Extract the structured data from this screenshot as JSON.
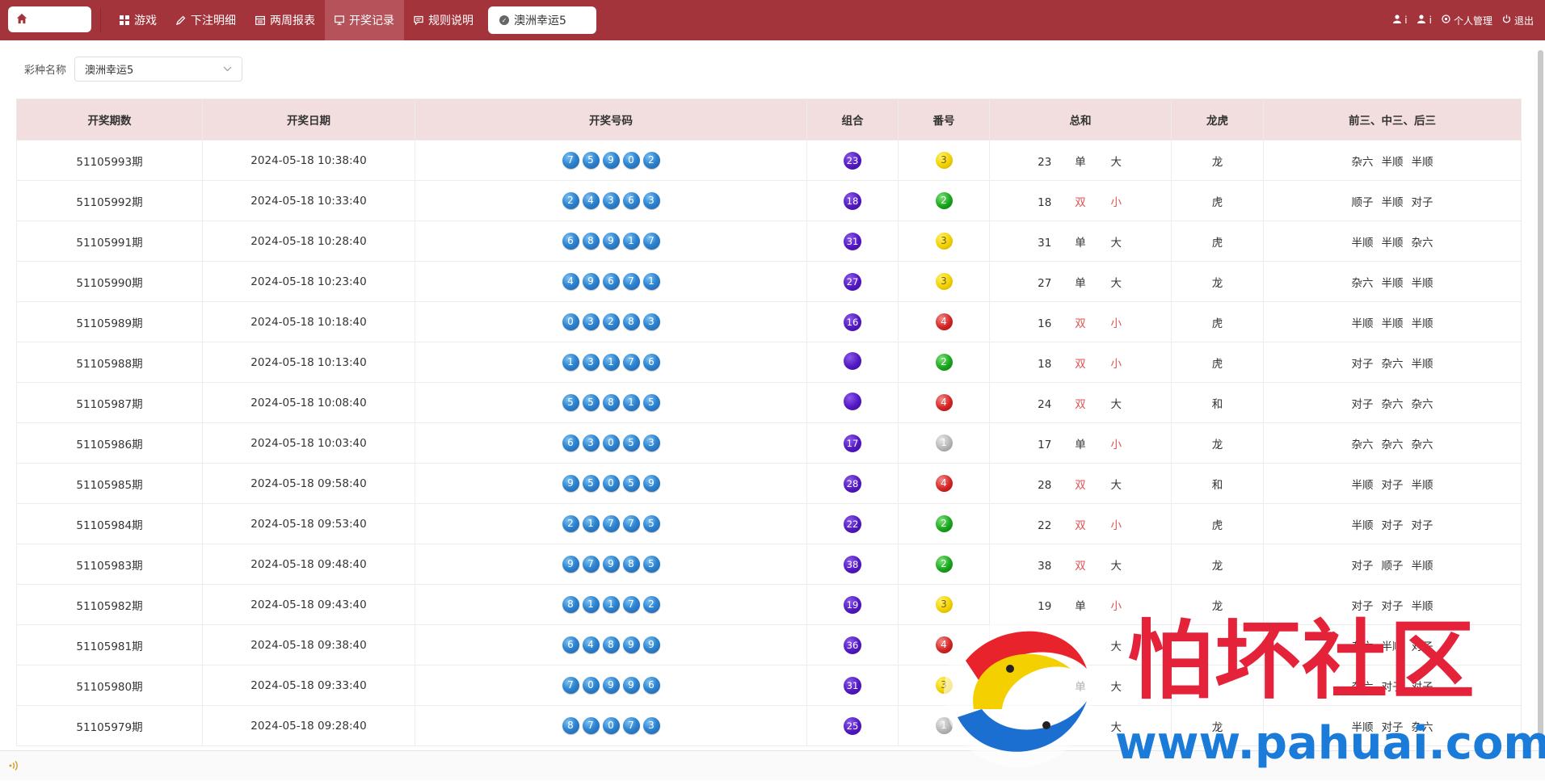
{
  "topbar": {
    "nav": [
      {
        "label": "游戏",
        "icon": "grid-icon"
      },
      {
        "label": "下注明细",
        "icon": "pen-icon"
      },
      {
        "label": "两周报表",
        "icon": "calendar-icon"
      },
      {
        "label": "开奖记录",
        "icon": "monitor-icon",
        "active": true
      },
      {
        "label": "规则说明",
        "icon": "message-icon"
      }
    ],
    "active_tab": "澳洲幸运5",
    "user_glyph_1": "ⅰ",
    "user_glyph_2": "ⅰ",
    "personal": "个人管理",
    "logout": "退出"
  },
  "filter": {
    "label": "彩种名称",
    "selected": "澳洲幸运5"
  },
  "table": {
    "headers": [
      "开奖期数",
      "开奖日期",
      "开奖号码",
      "组合",
      "番号",
      "总和",
      "龙虎",
      "前三、中三、后三"
    ],
    "rows": [
      {
        "issue": "51105993期",
        "date": "2024-05-18 10:38:40",
        "nums": [
          "7",
          "5",
          "9",
          "0",
          "2"
        ],
        "combo": "23",
        "fan": "3",
        "fan_color": "yellow",
        "sum": "23",
        "oe": "单",
        "bs": "大",
        "dt": "龙",
        "pattern": [
          "杂六",
          "半顺",
          "半顺"
        ]
      },
      {
        "issue": "51105992期",
        "date": "2024-05-18 10:33:40",
        "nums": [
          "2",
          "4",
          "3",
          "6",
          "3"
        ],
        "combo": "18",
        "fan": "2",
        "fan_color": "green",
        "sum": "18",
        "oe": "双",
        "bs": "小",
        "dt": "虎",
        "pattern": [
          "顺子",
          "半顺",
          "对子"
        ]
      },
      {
        "issue": "51105991期",
        "date": "2024-05-18 10:28:40",
        "nums": [
          "6",
          "8",
          "9",
          "1",
          "7"
        ],
        "combo": "31",
        "fan": "3",
        "fan_color": "yellow",
        "sum": "31",
        "oe": "单",
        "bs": "大",
        "dt": "虎",
        "pattern": [
          "半顺",
          "半顺",
          "杂六"
        ]
      },
      {
        "issue": "51105990期",
        "date": "2024-05-18 10:23:40",
        "nums": [
          "4",
          "9",
          "6",
          "7",
          "1"
        ],
        "combo": "27",
        "fan": "3",
        "fan_color": "yellow",
        "sum": "27",
        "oe": "单",
        "bs": "大",
        "dt": "龙",
        "pattern": [
          "杂六",
          "半顺",
          "半顺"
        ]
      },
      {
        "issue": "51105989期",
        "date": "2024-05-18 10:18:40",
        "nums": [
          "0",
          "3",
          "2",
          "8",
          "3"
        ],
        "combo": "16",
        "fan": "4",
        "fan_color": "red",
        "sum": "16",
        "oe": "双",
        "bs": "小",
        "dt": "虎",
        "pattern": [
          "半顺",
          "半顺",
          "半顺"
        ]
      },
      {
        "issue": "51105988期",
        "date": "2024-05-18 10:13:40",
        "nums": [
          "1",
          "3",
          "1",
          "7",
          "6"
        ],
        "combo": "",
        "fan": "2",
        "fan_color": "green",
        "sum": "18",
        "oe": "双",
        "bs": "小",
        "dt": "虎",
        "pattern": [
          "对子",
          "杂六",
          "半顺"
        ]
      },
      {
        "issue": "51105987期",
        "date": "2024-05-18 10:08:40",
        "nums": [
          "5",
          "5",
          "8",
          "1",
          "5"
        ],
        "combo": "",
        "fan": "4",
        "fan_color": "red",
        "sum": "24",
        "oe": "双",
        "bs": "大",
        "dt": "和",
        "pattern": [
          "对子",
          "杂六",
          "杂六"
        ]
      },
      {
        "issue": "51105986期",
        "date": "2024-05-18 10:03:40",
        "nums": [
          "6",
          "3",
          "0",
          "5",
          "3"
        ],
        "combo": "17",
        "fan": "1",
        "fan_color": "gray",
        "sum": "17",
        "oe": "单",
        "bs": "小",
        "dt": "龙",
        "pattern": [
          "杂六",
          "杂六",
          "杂六"
        ]
      },
      {
        "issue": "51105985期",
        "date": "2024-05-18 09:58:40",
        "nums": [
          "9",
          "5",
          "0",
          "5",
          "9"
        ],
        "combo": "28",
        "fan": "4",
        "fan_color": "red",
        "sum": "28",
        "oe": "双",
        "bs": "大",
        "dt": "和",
        "pattern": [
          "半顺",
          "对子",
          "半顺"
        ]
      },
      {
        "issue": "51105984期",
        "date": "2024-05-18 09:53:40",
        "nums": [
          "2",
          "1",
          "7",
          "7",
          "5"
        ],
        "combo": "22",
        "fan": "2",
        "fan_color": "green",
        "sum": "22",
        "oe": "双",
        "bs": "小",
        "dt": "虎",
        "pattern": [
          "半顺",
          "对子",
          "对子"
        ]
      },
      {
        "issue": "51105983期",
        "date": "2024-05-18 09:48:40",
        "nums": [
          "9",
          "7",
          "9",
          "8",
          "5"
        ],
        "combo": "38",
        "fan": "2",
        "fan_color": "green",
        "sum": "38",
        "oe": "双",
        "bs": "大",
        "dt": "龙",
        "pattern": [
          "对子",
          "顺子",
          "半顺"
        ]
      },
      {
        "issue": "51105982期",
        "date": "2024-05-18 09:43:40",
        "nums": [
          "8",
          "1",
          "1",
          "7",
          "2"
        ],
        "combo": "19",
        "fan": "3",
        "fan_color": "yellow",
        "sum": "19",
        "oe": "单",
        "bs": "小",
        "dt": "龙",
        "pattern": [
          "对子",
          "对子",
          "半顺"
        ]
      },
      {
        "issue": "51105981期",
        "date": "2024-05-18 09:38:40",
        "nums": [
          "6",
          "4",
          "8",
          "9",
          "9"
        ],
        "combo": "36",
        "fan": "4",
        "fan_color": "red",
        "sum": "",
        "oe": "",
        "bs": "大",
        "dt": "",
        "pattern": [
          "杂六",
          "半顺",
          "对子"
        ]
      },
      {
        "issue": "51105980期",
        "date": "2024-05-18 09:33:40",
        "nums": [
          "7",
          "0",
          "9",
          "9",
          "6"
        ],
        "combo": "31",
        "fan": "3",
        "fan_color": "yellow",
        "sum": "",
        "oe": "单",
        "bs": "大",
        "dt": "",
        "pattern": [
          "杂六",
          "对子",
          "对子"
        ]
      },
      {
        "issue": "51105979期",
        "date": "2024-05-18 09:28:40",
        "nums": [
          "8",
          "7",
          "0",
          "7",
          "3"
        ],
        "combo": "25",
        "fan": "1",
        "fan_color": "gray",
        "sum": "",
        "oe": "",
        "bs": "大",
        "dt": "龙",
        "pattern": [
          "半顺",
          "对子",
          "杂六"
        ]
      }
    ]
  },
  "watermark": {
    "title": "怕坏社区",
    "url": "www.pahuai.com"
  },
  "colors": {
    "topbar": "#a3343c",
    "header_bg": "#f2dede",
    "red_text": "#e05252"
  }
}
